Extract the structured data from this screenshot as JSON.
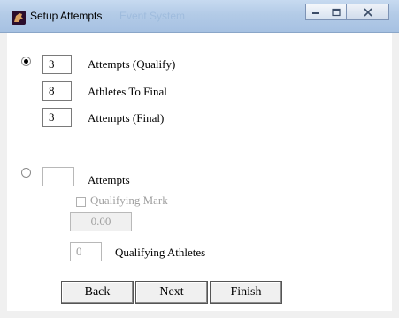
{
  "window": {
    "title": "Setup Attempts",
    "title_ghost": "Event System",
    "app_icon": "horse-head-icon",
    "caption_buttons": [
      "minimize-icon",
      "maximize-icon",
      "close-icon"
    ]
  },
  "qualify_section": {
    "selected": true,
    "attempts_qualify": {
      "value": "3",
      "label": "Attempts (Qualify)"
    },
    "athletes_to_final": {
      "value": "8",
      "label": "Athletes To Final"
    },
    "attempts_final": {
      "value": "3",
      "label": "Attempts (Final)"
    }
  },
  "straight_section": {
    "selected": false,
    "attempts": {
      "value": "",
      "label": "Attempts"
    },
    "qualifying_mark": {
      "checked": false,
      "label": "Qualifying Mark",
      "value": "0.00"
    },
    "qualifying_athletes": {
      "value": "0",
      "label": "Qualifying Athletes"
    }
  },
  "buttons": {
    "back": "Back",
    "next": "Next",
    "finish": "Finish"
  }
}
